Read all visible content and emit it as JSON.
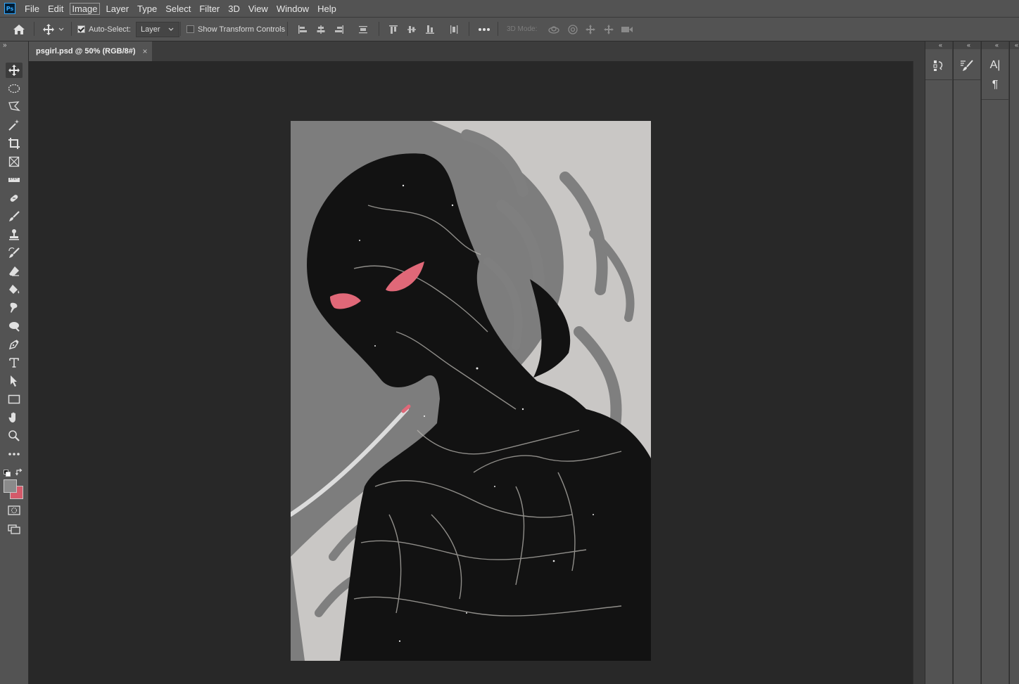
{
  "app": {
    "logo_text": "Ps"
  },
  "menu": [
    "File",
    "Edit",
    "Image",
    "Layer",
    "Type",
    "Select",
    "Filter",
    "3D",
    "View",
    "Window",
    "Help"
  ],
  "menu_active": "Image",
  "options": {
    "auto_select_label": "Auto-Select:",
    "auto_select_checked": true,
    "auto_select_target": "Layer",
    "show_transform_label": "Show Transform Controls",
    "show_transform_checked": false,
    "three_d_mode_label": "3D Mode:"
  },
  "document": {
    "tab_title": "psgirl.psd @ 50% (RGB/8#)"
  },
  "colors": {
    "foreground": "#8a8a8a",
    "background": "#d45a6a",
    "chrome": "#535353",
    "workspace": "#282828",
    "accent_eye": "#e06878"
  },
  "tools": [
    "move-icon",
    "ellipse-marquee-icon",
    "polygon-lasso-icon",
    "magic-wand-icon",
    "crop-icon",
    "frame-icon",
    "ruler-icon",
    "healing-brush-icon",
    "brush-icon",
    "clone-stamp-icon",
    "history-brush-icon",
    "eraser-icon",
    "paint-bucket-icon",
    "smudge-icon",
    "dodge-icon",
    "pen-icon",
    "type-icon",
    "path-select-icon",
    "rectangle-icon",
    "hand-icon",
    "zoom-icon",
    "more-tools-icon"
  ],
  "dock": {
    "collapse_glyph": "«",
    "panels": [
      "history-icon",
      "brush-settings-icon",
      "character-icon",
      "paragraph-icon"
    ],
    "paragraph_glyph": "¶",
    "character_glyph": "A|"
  }
}
